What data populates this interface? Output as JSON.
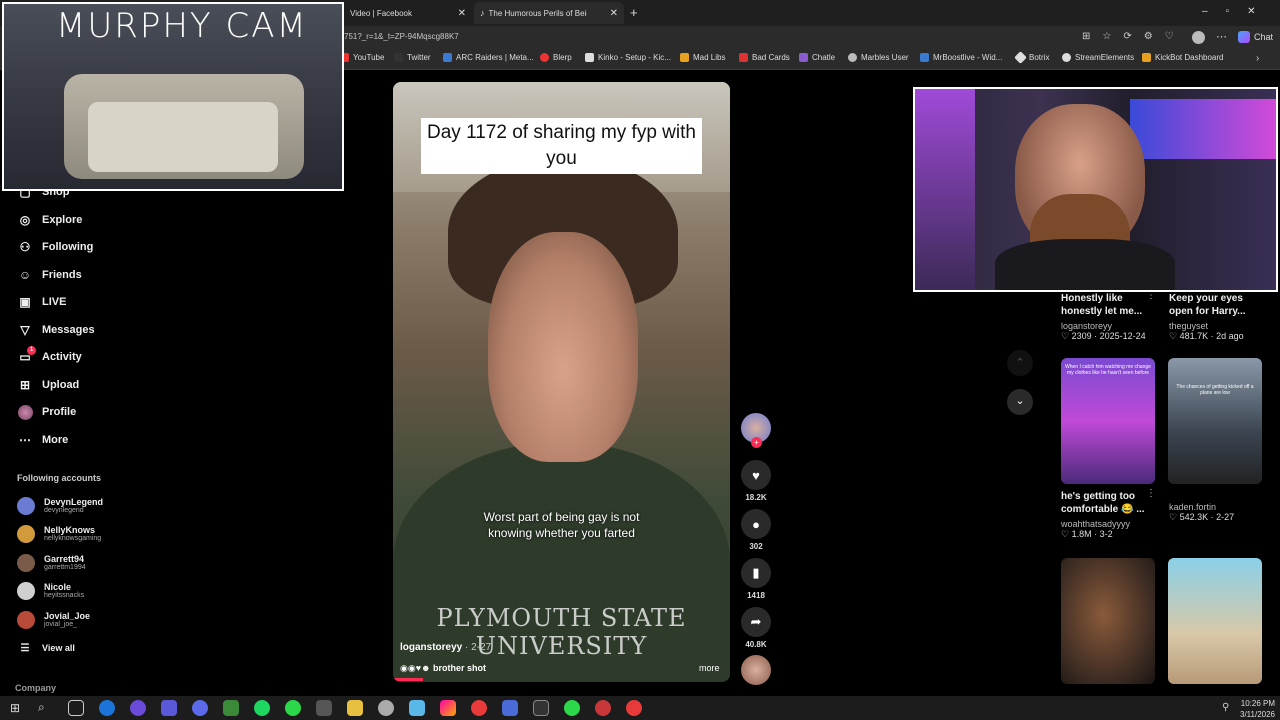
{
  "browser": {
    "tabs": [
      {
        "label": "Video | Facebook",
        "active": false
      },
      {
        "label": "The Humorous Perils of Being",
        "active": true
      }
    ],
    "url": "751?_r=1&_t=ZP-94Mqscg88K7",
    "bookmarks": [
      "YouTube",
      "Twitter",
      "ARC Raiders | Meta...",
      "Blerp",
      "Kinko - Setup - Kic...",
      "Mad Libs",
      "Bad Cards",
      "Chatle",
      "Marbles User",
      "MrBoostlive - Wid...",
      "Botrix",
      "StreamElements",
      "KickBot Dashboard"
    ],
    "chat_label": "Chat"
  },
  "sidebar": {
    "partial_item": "Shop",
    "items": [
      {
        "label": "Explore",
        "icon": "compass-icon"
      },
      {
        "label": "Following",
        "icon": "following-icon"
      },
      {
        "label": "Friends",
        "icon": "friends-icon"
      },
      {
        "label": "LIVE",
        "icon": "live-icon"
      },
      {
        "label": "Messages",
        "icon": "messages-icon"
      },
      {
        "label": "Activity",
        "icon": "activity-icon"
      },
      {
        "label": "Upload",
        "icon": "upload-icon"
      },
      {
        "label": "Profile",
        "icon": "profile-icon"
      },
      {
        "label": "More",
        "icon": "more-icon"
      }
    ],
    "activity_badge": "1",
    "following_header": "Following accounts",
    "accounts": [
      {
        "name": "DevynLegend",
        "handle": "devynlegend",
        "color": "#6a7bd1"
      },
      {
        "name": "NellyKnows",
        "handle": "nellyknowsgaming",
        "color": "#d19a3a"
      },
      {
        "name": "Garrett94",
        "handle": "garrettm1994",
        "color": "#7a5a48"
      },
      {
        "name": "Nicole",
        "handle": "heyitssnacks",
        "color": "#cfcfcf"
      },
      {
        "name": "Jovial_Joe",
        "handle": "jovial_joe_",
        "color": "#b84a3a"
      }
    ],
    "view_all": "View all",
    "company": "Company"
  },
  "video": {
    "top_caption": "Day 1172 of sharing my fyp with you",
    "subtitle": "Worst part of being gay is not knowing whether you farted",
    "shirt_text": "PLYMOUTH STATE UNIVERSITY",
    "author": "loganstoreyy",
    "age": "· 2-27",
    "description": "brother shot",
    "more": "more",
    "actions": {
      "likes": "18.2K",
      "comments": "302",
      "saves": "1418",
      "shares": "40.8K"
    }
  },
  "grid": [
    {
      "title": "Honestly like honestly let me...",
      "user": "loganstoreyy",
      "stats": "2309 · 2025-12-24"
    },
    {
      "title": "Keep your eyes open for Harry...",
      "user": "theguyset",
      "stats": "481.7K · 2d ago"
    },
    {
      "title": "he's getting too comfortable 😂 ...",
      "user": "woahthatsadyyyy",
      "stats": "1.8M · 3-2",
      "thumb_text": "When I catch him watching me change my clothes like he hasn't seen before"
    },
    {
      "title": "",
      "user": "kaden.fortin",
      "stats": "542.3K · 2-27",
      "thumb_text": "The chances of getting kicked off a plane are low"
    }
  ],
  "overlays": {
    "cam_title": "MURPHY CAM"
  },
  "taskbar": {
    "time": "10:26 PM",
    "date": "3/11/2026"
  }
}
